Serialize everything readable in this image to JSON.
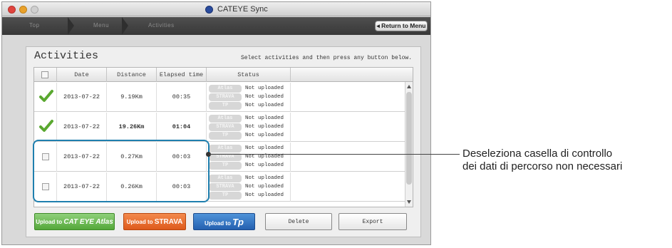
{
  "window": {
    "title": "CATEYE Sync",
    "breadcrumbs": [
      "Top",
      "Menu",
      "Activities"
    ],
    "return_button": "◂ Return to Menu"
  },
  "activities": {
    "title": "Activities",
    "instruction": "Select activities and then press any button below.",
    "columns": [
      "Date",
      "Distance",
      "Elapsed time",
      "Status"
    ],
    "services": [
      "Atlas",
      "STRAVA",
      "TP"
    ],
    "rows": [
      {
        "checked": true,
        "date": "2013-07-22",
        "distance": "9.19Km",
        "elapsed": "00:35",
        "statuses": [
          "Not uploaded",
          "Not uploaded",
          "Not uploaded"
        ]
      },
      {
        "checked": true,
        "date": "2013-07-22",
        "distance": "19.26Km",
        "elapsed": "01:04",
        "statuses": [
          "Not uploaded",
          "Not uploaded",
          "Not uploaded"
        ]
      },
      {
        "checked": false,
        "date": "2013-07-22",
        "distance": "0.27Km",
        "elapsed": "00:03",
        "statuses": [
          "Not uploaded",
          "Not uploaded",
          "Not uploaded"
        ]
      },
      {
        "checked": false,
        "date": "2013-07-22",
        "distance": "0.26Km",
        "elapsed": "00:03",
        "statuses": [
          "Not uploaded",
          "Not uploaded",
          "Not uploaded"
        ]
      }
    ]
  },
  "buttons": {
    "upload_atlas_prefix": "Upload to",
    "upload_atlas_brand": "CAT EYE Atlas",
    "upload_strava_prefix": "Upload to",
    "upload_strava_brand": "STRAVA",
    "upload_tp_prefix": "Upload to",
    "upload_tp_brand": "Tp",
    "delete": "Delete",
    "export": "Export"
  },
  "callout": {
    "line1": "Deseleziona casella di controllo",
    "line2": "dei dati di percorso non necessari"
  },
  "colors": {
    "highlight": "#1f7fae",
    "atlas_green": "#54a83a",
    "strava_orange": "#de5a1c",
    "tp_blue": "#2460b0",
    "checkmark": "#5aa830"
  },
  "icons": {
    "checked": "checkmark-icon",
    "unchecked": "checkbox-icon"
  }
}
